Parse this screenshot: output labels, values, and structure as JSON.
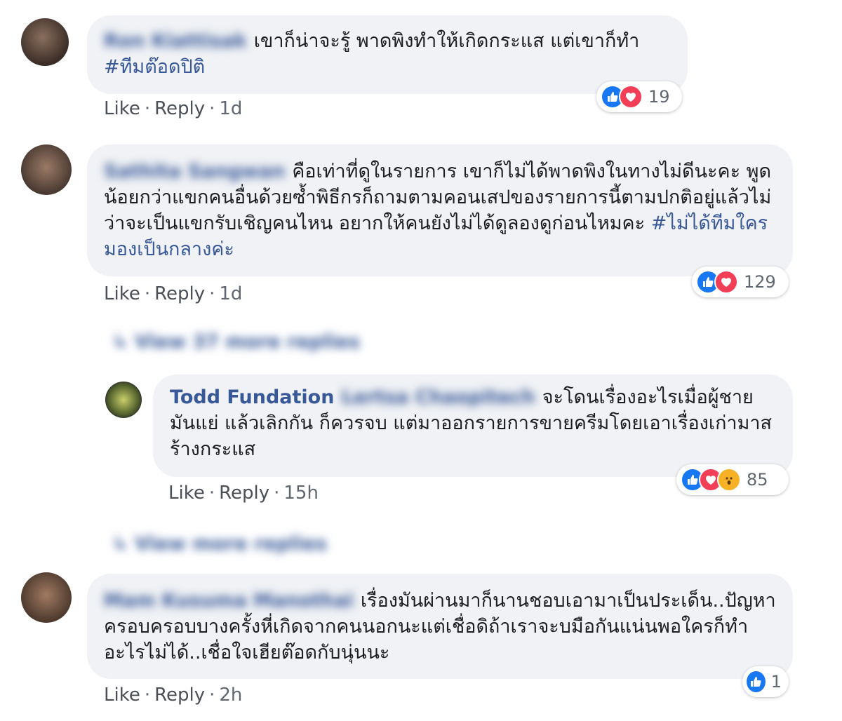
{
  "comments": [
    {
      "name": "Ron Kiattisak",
      "text": "เขาก็น่าจะรู้ พาดพิงทำให้เกิดกระแส แต่เขาก็ทำ",
      "hashtag": "#ทีมต๊อดปิติ",
      "like": "Like",
      "reply": "Reply",
      "time": "1d",
      "reaction_count": "19"
    },
    {
      "name": "Sathita Sangwan",
      "text": "คือเท่าที่ดูในรายการ เขาก็ไม่ได้พาดพิงในทางไม่ดีนะคะ พูดน้อยกว่าแขกคนอื่นด้วยซ้ำพิธีกรก็ถามตามคอนเสปของรายการนี้ตามปกติอยู่แล้วไม่ว่าจะเป็นแขกรับเชิญคนไหน อยากให้คนยังไม่ได้ดูลองดูก่อนไหมคะ",
      "hashtag": "#ไม่ได้ทีมใครมองเป็นกลางค่ะ",
      "like": "Like",
      "reply": "Reply",
      "time": "1d",
      "reaction_count": "129"
    },
    {
      "name": "Todd Fundation",
      "tagged": "Lertsa Chaopitech",
      "text": "จะโดนเรื่องอะไรเมื่อผู้ชายมันแย่ แล้วเลิกกัน ก็ควรจบ แต่มาออกรายการขายครีมโดยเอาเรื่องเก่ามาสร้างกระแส",
      "like": "Like",
      "reply": "Reply",
      "time": "15h",
      "reaction_count": "85"
    },
    {
      "name": "Mam Kusuma Manothai",
      "text": "เรื่องมันผ่านมาก็นานชอบเอามาเป็นประเด็น..ปัญหาครอบครอบบางครั้งหี่เกิดจากคนนอกนะแต่เชื่อดิถ้าเราจะบมือกันแน่นพอใครก็ทำอะไรไม่ได้..เชื่อใจเฮียต๊อดกับนุ่นนะ",
      "like": "Like",
      "reply": "Reply",
      "time": "2h",
      "reaction_count": "1"
    }
  ],
  "view_more_1": "View 37 more replies",
  "view_more_2": "View more replies",
  "separator": "·",
  "colors": {
    "bubble": "#f0f2f5",
    "link": "#385898",
    "like": "#1877f2",
    "love": "#f33e58",
    "wow": "#f7b125"
  }
}
